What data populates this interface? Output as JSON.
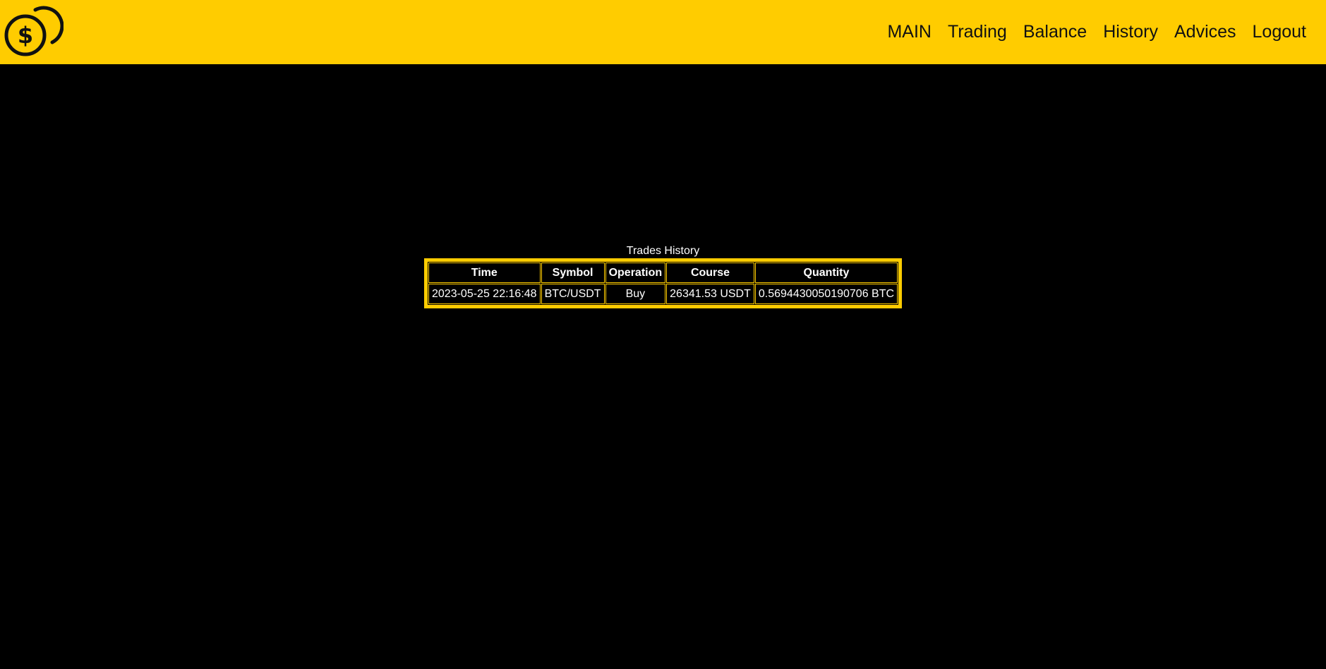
{
  "colors": {
    "brand": "#ffcc00",
    "background": "#000000",
    "text_light": "#ffffff",
    "text_dark": "#111111"
  },
  "header": {
    "logo_icon": "dollar-coins-icon",
    "nav": [
      {
        "label": "MAIN"
      },
      {
        "label": "Trading"
      },
      {
        "label": "Balance"
      },
      {
        "label": "History"
      },
      {
        "label": "Advices"
      },
      {
        "label": "Logout"
      }
    ]
  },
  "main": {
    "table_caption": "Trades History",
    "columns": [
      "Time",
      "Symbol",
      "Operation",
      "Course",
      "Quantity"
    ],
    "rows": [
      {
        "time": "2023-05-25 22:16:48",
        "symbol": "BTC/USDT",
        "operation": "Buy",
        "course": "26341.53 USDT",
        "quantity": "0.5694430050190706 BTC"
      }
    ]
  }
}
